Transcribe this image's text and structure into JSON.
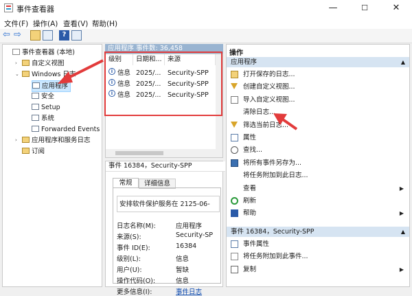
{
  "window": {
    "title": "事件查看器",
    "min": "—",
    "max": "☐",
    "close": "✕"
  },
  "menu": [
    "文件(F)",
    "操作(A)",
    "查看(V)",
    "帮助(H)"
  ],
  "tree": [
    {
      "label": "事件查看器 (本地)",
      "indent": 0,
      "exp": ""
    },
    {
      "label": "自定义视图",
      "indent": 1,
      "exp": "›"
    },
    {
      "label": "Windows 日志",
      "indent": 1,
      "exp": "⌄"
    },
    {
      "label": "应用程序",
      "indent": 2,
      "exp": "",
      "selected": true
    },
    {
      "label": "安全",
      "indent": 2,
      "exp": ""
    },
    {
      "label": "Setup",
      "indent": 2,
      "exp": ""
    },
    {
      "label": "系统",
      "indent": 2,
      "exp": ""
    },
    {
      "label": "Forwarded Events",
      "indent": 2,
      "exp": ""
    },
    {
      "label": "应用程序和服务日志",
      "indent": 1,
      "exp": "›"
    },
    {
      "label": "订阅",
      "indent": 1,
      "exp": ""
    }
  ],
  "list": {
    "header": "应用程序   事件数: 36,458",
    "columns": [
      "级别",
      "日期和...",
      "来源"
    ],
    "rows": [
      {
        "level": "信息",
        "date": "2025/...",
        "source": "Security-SPP"
      },
      {
        "level": "信息",
        "date": "2025/...",
        "source": "Security-SPP"
      },
      {
        "level": "信息",
        "date": "2025/...",
        "source": "Security-SPP"
      }
    ]
  },
  "detail": {
    "header": "事件 16384，Security-SPP",
    "tabs": [
      "常规",
      "详细信息"
    ],
    "message": "安排软件保护服务在 2125-06-",
    "fields": [
      {
        "label": "日志名称(M):",
        "value": "应用程序"
      },
      {
        "label": "来源(S):",
        "value": "Security-SP"
      },
      {
        "label": "事件 ID(E):",
        "value": "16384"
      },
      {
        "label": "级别(L):",
        "value": "信息"
      },
      {
        "label": "用户(U):",
        "value": "暂缺"
      },
      {
        "label": "操作代码(O):",
        "value": "信息"
      },
      {
        "label": "更多信息(I):",
        "value": "事件日志"
      }
    ]
  },
  "actions": {
    "title": "操作",
    "section1": "应用程序",
    "items1": [
      {
        "label": "打开保存的日志...",
        "icon": "folder-icon",
        "sub": false
      },
      {
        "label": "创建自定义视图...",
        "icon": "filter-icon",
        "sub": false
      },
      {
        "label": "导入自定义视图...",
        "icon": "import-icon",
        "sub": false
      },
      {
        "label": "清除日志...",
        "icon": "",
        "sub": false
      },
      {
        "label": "筛选当前日志...",
        "icon": "filter-icon",
        "sub": false
      },
      {
        "label": "属性",
        "icon": "properties-icon",
        "sub": false
      },
      {
        "label": "查找...",
        "icon": "find-icon",
        "sub": false
      },
      {
        "label": "将所有事件另存为...",
        "icon": "save-icon",
        "sub": false
      },
      {
        "label": "将任务附加到此日志...",
        "icon": "",
        "sub": false
      },
      {
        "label": "查看",
        "icon": "",
        "sub": true
      },
      {
        "label": "刷新",
        "icon": "refresh-icon",
        "sub": false
      },
      {
        "label": "帮助",
        "icon": "help-icon",
        "sub": true
      }
    ],
    "section2": "事件 16384，Security-SPP",
    "items2": [
      {
        "label": "事件属性",
        "icon": "properties-icon",
        "sub": false
      },
      {
        "label": "将任务附加到此事件...",
        "icon": "task-icon",
        "sub": false
      },
      {
        "label": "复制",
        "icon": "copy-icon",
        "sub": true
      }
    ]
  },
  "colors": {
    "accent": "#e23b3b",
    "selection": "#cce8ff",
    "header": "#99b4d1"
  }
}
